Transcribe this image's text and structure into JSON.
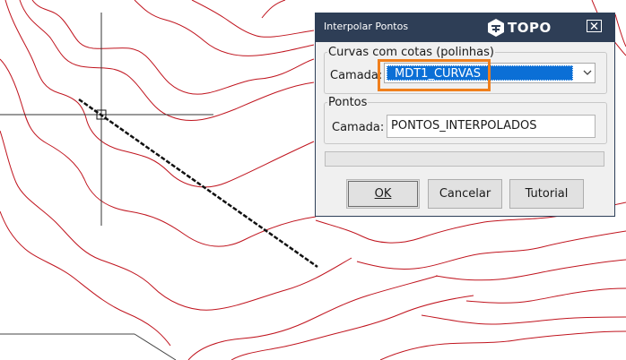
{
  "dialog": {
    "title": "Interpolar Pontos",
    "brand": "TOPO",
    "close_icon": "close-icon"
  },
  "group_curves": {
    "legend": "Curvas com cotas (polinhas)",
    "layer_label": "Camada:",
    "selected_layer": "MDT1_CURVAS"
  },
  "group_points": {
    "legend": "Pontos",
    "layer_label": "Camada:",
    "layer_value": "PONTOS_INTERPOLADOS"
  },
  "progress": {
    "value": 0
  },
  "buttons": {
    "ok": "OK",
    "cancel": "Cancelar",
    "tutorial": "Tutorial"
  },
  "colors": {
    "contour": "#c0141e",
    "titlebar": "#2e3e56",
    "selection": "#0b6fd6",
    "highlight": "#f07f1c"
  }
}
